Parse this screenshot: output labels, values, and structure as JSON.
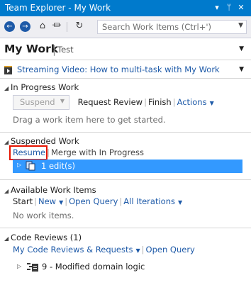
{
  "window": {
    "title": "Team Explorer - My Work",
    "controls": {
      "dropdown": "▾",
      "pin": "ᛘ",
      "close": "✕"
    }
  },
  "toolbar": {
    "search_placeholder": "Search Work Items (Ctrl+')"
  },
  "header": {
    "title": "My Work",
    "separator": "|",
    "context": "Test"
  },
  "video_link": "Streaming Video: How to multi-task with My Work",
  "in_progress": {
    "heading": "In Progress Work",
    "suspend_label": "Suspend",
    "request_review": "Request Review",
    "finish": "Finish",
    "actions": "Actions",
    "hint": "Drag a work item here to get started."
  },
  "suspended": {
    "heading": "Suspended Work",
    "resume": "Resume",
    "merge": "Merge with In Progress",
    "item": "1 edit(s)"
  },
  "available": {
    "heading": "Available Work Items",
    "start": "Start",
    "new": "New",
    "open_query": "Open Query",
    "all_iterations": "All Iterations",
    "empty": "No work items."
  },
  "reviews": {
    "heading": "Code Reviews (1)",
    "my_reviews": "My Code Reviews & Requests",
    "open_query": "Open Query",
    "item": "9 - Modified domain logic"
  },
  "colors": {
    "accent": "#007acc",
    "link": "#1e5aa8",
    "selection": "#3399ff",
    "highlight_box": "#e51400"
  }
}
